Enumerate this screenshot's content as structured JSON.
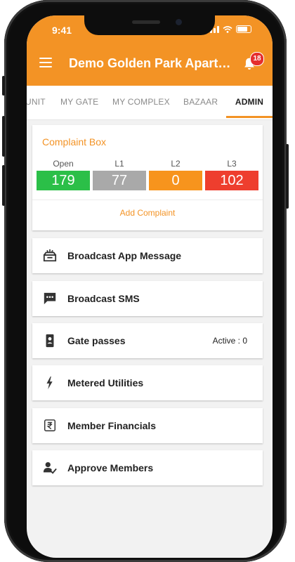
{
  "status_bar": {
    "time": "9:41"
  },
  "app_bar": {
    "title": "Demo Golden Park Apartm...",
    "notification_count": "18"
  },
  "tabs": [
    {
      "label": "UNIT"
    },
    {
      "label": "MY GATE"
    },
    {
      "label": "MY COMPLEX"
    },
    {
      "label": "BAZAAR"
    },
    {
      "label": "ADMIN",
      "active": true
    }
  ],
  "complaint_box": {
    "title": "Complaint Box",
    "stats": [
      {
        "label": "Open",
        "value": "179",
        "color": "#2bbf48"
      },
      {
        "label": "L1",
        "value": "77",
        "color": "#a9a9a9"
      },
      {
        "label": "L2",
        "value": "0",
        "color": "#f7941d"
      },
      {
        "label": "L3",
        "value": "102",
        "color": "#ee3e2e"
      }
    ],
    "add_label": "Add Complaint"
  },
  "menu_items": [
    {
      "label": "Broadcast App Message",
      "icon": "broadcast-message-icon"
    },
    {
      "label": "Broadcast SMS",
      "icon": "sms-icon"
    },
    {
      "label": "Gate passes",
      "icon": "gate-pass-icon",
      "value": "Active : 0"
    },
    {
      "label": "Metered Utilities",
      "icon": "lightning-icon"
    },
    {
      "label": "Member Financials",
      "icon": "rupee-icon"
    },
    {
      "label": "Approve Members",
      "icon": "approve-member-icon"
    }
  ],
  "colors": {
    "accent": "#f39325",
    "background": "#f2f2f2"
  }
}
